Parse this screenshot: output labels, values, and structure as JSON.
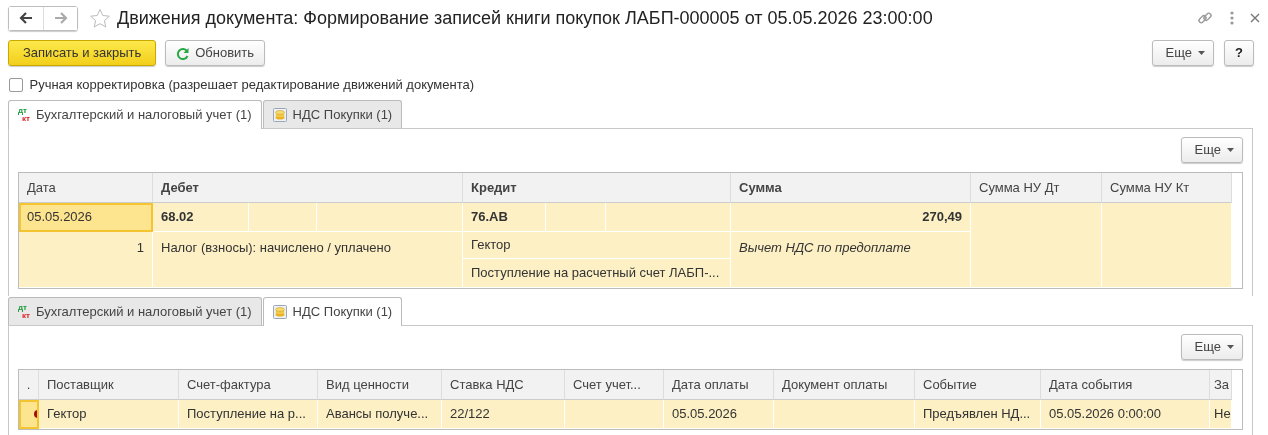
{
  "window": {
    "title": "Движения документа: Формирование записей книги покупок ЛАБП-000005 от 05.05.2026 23:00:00",
    "favorite": false
  },
  "toolbar": {
    "save_close": "Записать и закрыть",
    "refresh": "Обновить",
    "more": "Еще",
    "help": "?"
  },
  "manual_correction": {
    "label": "Ручная корректировка (разрешает редактирование движений документа)",
    "checked": false
  },
  "accounting_panel": {
    "tabs": [
      {
        "label": "Бухгалтерский и налоговый учет (1)",
        "selected": true,
        "icon": {
          "kind": "debit_credit",
          "top": "дт",
          "bottom": "кт"
        }
      },
      {
        "label": "НДС Покупки (1)",
        "selected": false,
        "icon": {
          "kind": "coins"
        }
      }
    ],
    "more": "Еще",
    "columns": [
      {
        "label": "Дата",
        "bold": false
      },
      {
        "label": "Дебет",
        "bold": true
      },
      {
        "label": "Кредит",
        "bold": true
      },
      {
        "label": "Сумма",
        "bold": true
      },
      {
        "label": "Сумма НУ Дт",
        "bold": false
      },
      {
        "label": "Сумма НУ Кт",
        "bold": false
      }
    ],
    "rows": [
      {
        "selected": true,
        "date": "05.05.2026",
        "number": "1",
        "debit_account": "68.02",
        "debit_subconto": "Налог (взносы): начислено / уплачено",
        "credit_account": "76.АВ",
        "credit_subconto": [
          "Гектор",
          "Поступление на расчетный счет ЛАБП-..."
        ],
        "amount": "270,49",
        "content": "Вычет НДС по предоплате"
      }
    ]
  },
  "vat_panel": {
    "tabs": [
      {
        "label": "Бухгалтерский и налоговый учет (1)",
        "selected": false,
        "icon": {
          "kind": "debit_credit",
          "top": "дт",
          "bottom": "кт"
        }
      },
      {
        "label": "НДС Покупки (1)",
        "selected": true,
        "icon": {
          "kind": "coins"
        }
      }
    ],
    "more": "Еще",
    "columns": [
      ".",
      "Поставщик",
      "Счет-фактура",
      "Вид ценности",
      "Ставка НДС",
      "Счет учет...",
      "Дата оплаты",
      "Документ оплаты",
      "Событие",
      "Дата события",
      "За"
    ],
    "rows": [
      {
        "selected": true,
        "marker": true,
        "cells": [
          "",
          "Гектор",
          "Поступление на р...",
          "Авансы получе...",
          "22/122",
          "",
          "05.05.2026",
          "",
          "Предъявлен НД...",
          "05.05.2026 0:00:00",
          "Не"
        ]
      }
    ]
  }
}
